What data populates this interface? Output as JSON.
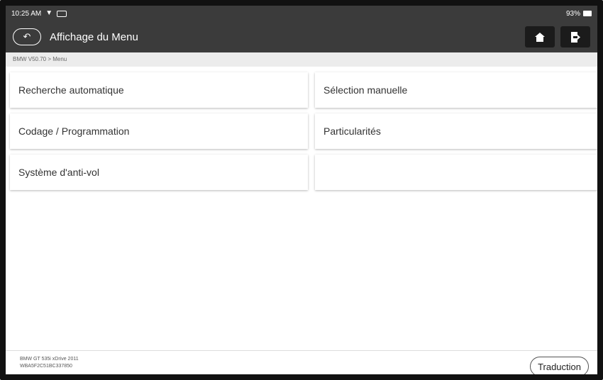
{
  "status": {
    "time": "10:25 AM",
    "battery": "93%"
  },
  "header": {
    "back_icon": "↶",
    "title": "Affichage du Menu",
    "home_icon": "home-icon",
    "exit_icon": "exit-icon"
  },
  "breadcrumb": "BMW V50.70 > Menu",
  "menu": {
    "items": [
      {
        "label": "Recherche automatique"
      },
      {
        "label": "Sélection manuelle"
      },
      {
        "label": "Codage / Programmation"
      },
      {
        "label": "Particularités"
      },
      {
        "label": "Système d'anti-vol"
      },
      {
        "label": ""
      }
    ]
  },
  "footer": {
    "vehicle_line1": "BMW GT 535i xDrive 2011",
    "vehicle_line2": "WBA5F2C51BC337850",
    "translate_label": "Traduction"
  }
}
